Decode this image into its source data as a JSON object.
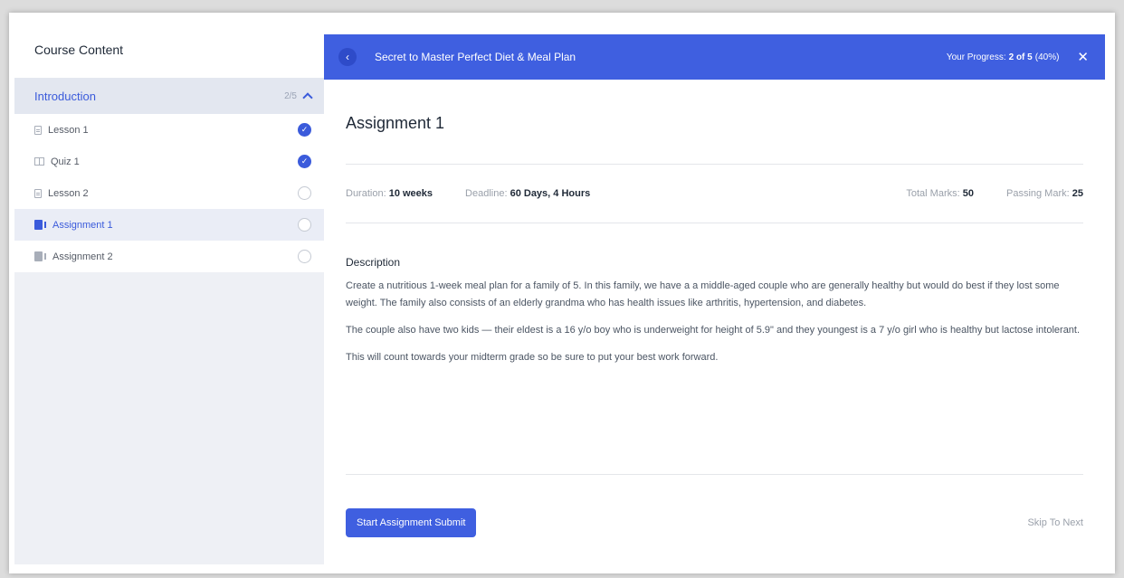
{
  "sidebar": {
    "title": "Course Content",
    "section": {
      "label": "Introduction",
      "count": "2/5"
    },
    "items": [
      {
        "label": "Lesson 1",
        "icon": "lesson-icon",
        "status": "completed"
      },
      {
        "label": "Quiz 1",
        "icon": "quiz-icon",
        "status": "completed"
      },
      {
        "label": "Lesson 2",
        "icon": "lesson-icon",
        "status": "incomplete"
      },
      {
        "label": "Assignment 1",
        "icon": "assignment-icon",
        "status": "active"
      },
      {
        "label": "Assignment 2",
        "icon": "assignment-icon",
        "status": "incomplete"
      }
    ]
  },
  "header": {
    "back_icon": "chevron-left-icon",
    "course_title": "Secret to Master Perfect Diet & Meal Plan",
    "progress_label": "Your Progress:",
    "progress_value": "2 of 5",
    "progress_percent": "(40%)",
    "close_icon": "close-icon"
  },
  "main": {
    "title": "Assignment 1",
    "meta": {
      "duration_label": "Duration:",
      "duration_value": "10 weeks",
      "deadline_label": "Deadline:",
      "deadline_value": "60 Days, 4 Hours",
      "total_label": "Total Marks:",
      "total_value": "50",
      "passing_label": "Passing Mark:",
      "passing_value": "25"
    },
    "description_heading": "Description",
    "paragraphs": [
      "Create a nutritious 1-week meal plan for a family of 5. In this family, we have a a middle-aged couple who are generally healthy but would do best if they lost some weight. The family also consists of an elderly grandma who has health issues like arthritis, hypertension, and diabetes.",
      "The couple also have two kids — their eldest is a 16 y/o boy who is underweight for height of 5.9\" and they youngest is a 7 y/o girl who is healthy but lactose intolerant.",
      "This will count towards your midterm grade so be sure to put your best work forward."
    ]
  },
  "footer": {
    "start_label": "Start Assignment Submit",
    "skip_label": "Skip To Next"
  },
  "colors": {
    "accent": "#3f5fe0",
    "sidebar_bg": "#eef0f5"
  }
}
